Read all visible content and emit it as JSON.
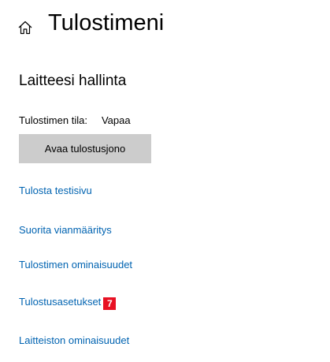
{
  "header": {
    "title": "Tulostimeni",
    "home_icon": "home-icon"
  },
  "section": {
    "title": "Laitteesi hallinta",
    "status_label": "Tulostimen tila:",
    "status_value": "Vapaa",
    "queue_button_label": "Avaa tulostusjono"
  },
  "links": [
    {
      "label": "Tulosta testisivu"
    },
    {
      "label": "Suorita vianmääritys"
    },
    {
      "label": "Tulostimen ominaisuudet"
    },
    {
      "label": "Tulostusasetukset",
      "badge": "7"
    },
    {
      "label": "Laitteiston ominaisuudet"
    }
  ],
  "colors": {
    "link": "#0063b1",
    "button_bg": "#cccccc",
    "badge_bg": "#e81123"
  }
}
